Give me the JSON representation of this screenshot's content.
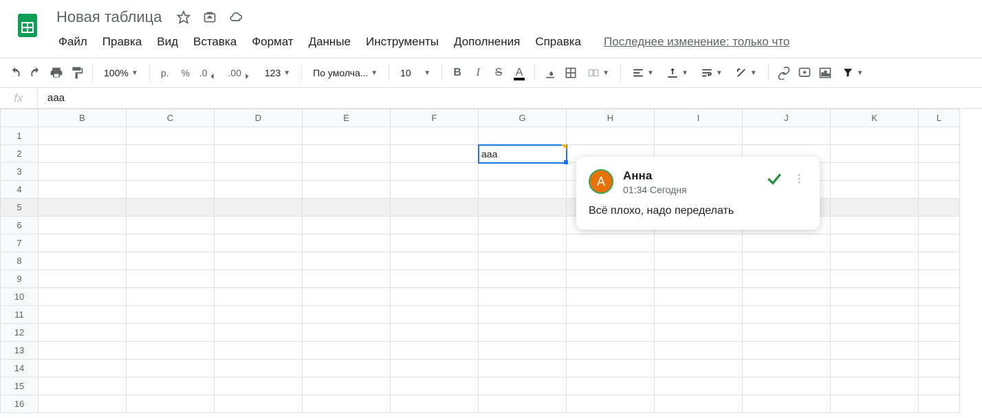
{
  "header": {
    "doc_title": "Новая таблица"
  },
  "menubar": {
    "items": [
      "Файл",
      "Правка",
      "Вид",
      "Вставка",
      "Формат",
      "Данные",
      "Инструменты",
      "Дополнения",
      "Справка"
    ],
    "lastchange": "Последнее изменение: только что"
  },
  "toolbar": {
    "zoom": "100%",
    "currency": "р.",
    "percent": "%",
    "nums": "123",
    "font": "По умолча...",
    "fontsize": "10"
  },
  "fx": {
    "label": "fx",
    "value": "ааа"
  },
  "grid": {
    "cols": [
      "B",
      "C",
      "D",
      "E",
      "F",
      "G",
      "H",
      "I",
      "J",
      "K",
      "L"
    ],
    "rows": [
      1,
      2,
      3,
      4,
      5,
      6,
      7,
      8,
      9,
      10,
      11,
      12,
      13,
      14,
      15,
      16
    ],
    "selected_cell_value": "ааа"
  },
  "comment": {
    "avatar_letter": "А",
    "author": "Анна",
    "timestamp": "01:34 Сегодня",
    "text": "Всё плохо, надо переделать"
  }
}
